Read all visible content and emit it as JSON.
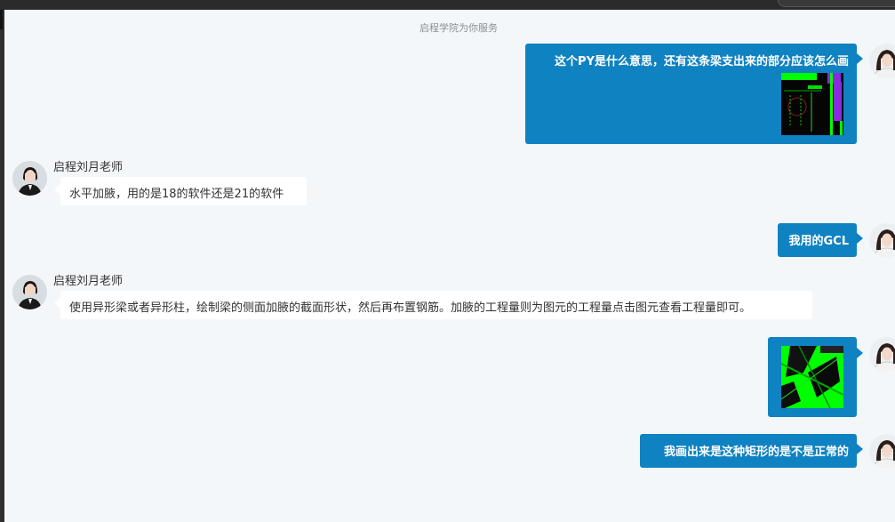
{
  "header": {
    "service_note": "启程学院为你服务"
  },
  "teacher": {
    "name": "启程刘月老师"
  },
  "messages": [
    {
      "from": "user",
      "text": "这个PY是什么意思，还有这条梁支出来的部分应该怎么画",
      "has_image": true
    },
    {
      "from": "teacher",
      "text": "水平加腋，用的是18的软件还是21的软件"
    },
    {
      "from": "user",
      "text": "我用的GCL"
    },
    {
      "from": "teacher",
      "text": "使用异形梁或者异形柱，绘制梁的侧面加腋的截面形状，然后再布置钢筋。加腋的工程量则为图元的工程量点击图元查看工程量即可。"
    },
    {
      "from": "user",
      "text": "",
      "has_image": true
    },
    {
      "from": "user",
      "text": "我画出来是这种矩形的是不是正常的"
    }
  ],
  "colors": {
    "user_bubble": "#0f82c2",
    "teacher_bubble": "#ffffff",
    "background": "#f4f7f9",
    "cad_green": "#00ff00",
    "cad_purple": "#8a2be2"
  },
  "icons": {
    "avatar_user": "user-avatar-icon",
    "avatar_teacher": "teacher-avatar-icon"
  }
}
